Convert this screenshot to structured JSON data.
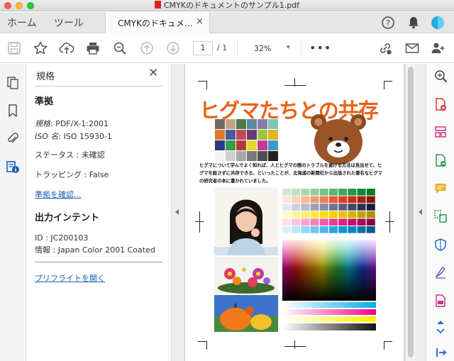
{
  "window": {
    "title": "CMYKのドキュメントのサンプル1.pdf"
  },
  "menu": {
    "home": "ホーム",
    "tools": "ツール"
  },
  "tab": {
    "label": "CMYKのドキュメ…",
    "close": "×"
  },
  "toolbar": {
    "page_current": "1",
    "page_total": "/ 1",
    "zoom": "32%",
    "zoom_caret": "▾",
    "more": "•••"
  },
  "panel": {
    "title": "規格",
    "close": "✕",
    "section_conformance": "準拠",
    "standard_label": "規格",
    "standard_value": ": PDF/X-1:2001",
    "iso_label": "ISO 名",
    "iso_value": ": ISO 15930-1",
    "status": "ステータス : 未確認",
    "trapping": "トラッピング : False",
    "verify_link": "準拠を確認...",
    "section_output": "出力インテント",
    "output_id": "ID : JC200103",
    "output_info": "情報 : Japan Color 2001 Coated",
    "preflight_link": "プリフライトを開く"
  },
  "document": {
    "title": "ヒグマたちとの共存",
    "body": "ヒグマについて学んでよく知れば、人とヒグマの間のトラブルを避ける方法は見出せて、ヒグマを殺さずに共存できる、といったことが、北海道の新聞社から出版された著名なヒグマの研究者の本に書かれていました。"
  },
  "colors": {
    "accent_orange": "#e8631a",
    "link_blue": "#1a5fb4",
    "rail_red": "#d93a3a",
    "rail_magenta": "#d6337a",
    "rail_green": "#2d9c5a",
    "rail_yellow": "#e8b32a",
    "rail_purple": "#7b4fc9",
    "rail_blue": "#2a6ed6"
  },
  "icons": {
    "left_rail": [
      "pages-icon",
      "bookmark-icon",
      "attachment-icon",
      "standards-icon"
    ],
    "right_rail": [
      "zoom-search-icon",
      "create-pdf-icon",
      "organize-pages-icon",
      "export-pdf-icon",
      "comment-icon",
      "edit-pdf-icon",
      "protect-icon",
      "fill-sign-icon",
      "more-tools-icon",
      "scroll-up-icon",
      "scroll-down-icon",
      "collapse-panel-icon"
    ]
  }
}
